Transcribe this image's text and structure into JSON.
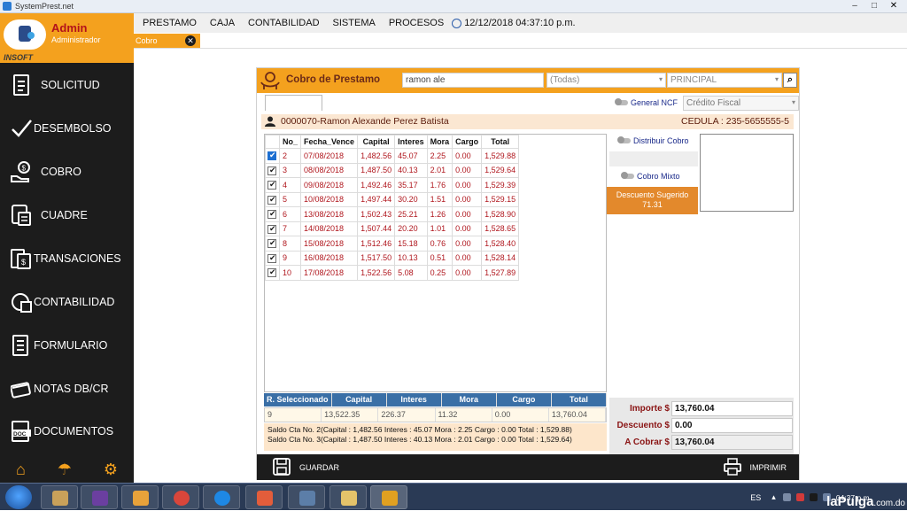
{
  "window": {
    "title": "SystemPrest.net",
    "controls": [
      "–",
      "□",
      "✕"
    ]
  },
  "sidebar": {
    "user_name": "Admin",
    "user_role": "Administrador",
    "brand": "INSOFT",
    "items": [
      {
        "label": "SOLICITUD",
        "icon": "document-icon"
      },
      {
        "label": "DESEMBOLSO",
        "icon": "checkmark-icon"
      },
      {
        "label": "COBRO",
        "icon": "hand-coin-icon"
      },
      {
        "label": "CUADRE",
        "icon": "calculator-icon"
      },
      {
        "label": "TRANSACIONES",
        "icon": "money-bills-icon"
      },
      {
        "label": "CONTABILIDAD",
        "icon": "accounting-icon"
      },
      {
        "label": "FORMULARIO",
        "icon": "form-icon"
      },
      {
        "label": "NOTAS DB/CR",
        "icon": "card-icon"
      },
      {
        "label": "DOCUMENTOS",
        "icon": "doc-file-icon"
      }
    ],
    "footer_icons": [
      "home-icon",
      "umbrella-icon",
      "gear-icon"
    ]
  },
  "menubar": {
    "items": [
      "PRESTAMO",
      "CAJA",
      "CONTABILIDAD",
      "SISTEMA",
      "PROCESOS"
    ],
    "datetime": "12/12/2018 04:37:10 p.m."
  },
  "tabs": {
    "active": "Cobro",
    "close": "✕"
  },
  "panel": {
    "title": "Cobro de Prestamo",
    "search_value": "ramon ale",
    "filter_value": "(Todas)",
    "branch_value": "PRINCIPAL",
    "ncf_toggle_label": "General NCF",
    "ncf_type": "Crédito Fiscal",
    "client_name": "0000070-Ramon Alexande Perez Batista",
    "client_cedula": "CEDULA : 235-5655555-5",
    "distribuir_label": "Distribuir Cobro",
    "mixto_label": "Cobro Mixto",
    "descuento_sugerido_label": "Descuento Sugerido",
    "descuento_sugerido_value": "71.31",
    "table": {
      "headers": [
        "No_",
        "Fecha_Vence",
        "Capital",
        "Interes",
        "Mora",
        "Cargo",
        "Total"
      ],
      "rows": [
        {
          "no": "2",
          "fecha": "07/08/2018",
          "capital": "1,482.56",
          "interes": "45.07",
          "mora": "2.25",
          "cargo": "0.00",
          "total": "1,529.88",
          "checked": true,
          "focus": true
        },
        {
          "no": "3",
          "fecha": "08/08/2018",
          "capital": "1,487.50",
          "interes": "40.13",
          "mora": "2.01",
          "cargo": "0.00",
          "total": "1,529.64",
          "checked": true,
          "focus": false
        },
        {
          "no": "4",
          "fecha": "09/08/2018",
          "capital": "1,492.46",
          "interes": "35.17",
          "mora": "1.76",
          "cargo": "0.00",
          "total": "1,529.39",
          "checked": true,
          "focus": false
        },
        {
          "no": "5",
          "fecha": "10/08/2018",
          "capital": "1,497.44",
          "interes": "30.20",
          "mora": "1.51",
          "cargo": "0.00",
          "total": "1,529.15",
          "checked": true,
          "focus": false
        },
        {
          "no": "6",
          "fecha": "13/08/2018",
          "capital": "1,502.43",
          "interes": "25.21",
          "mora": "1.26",
          "cargo": "0.00",
          "total": "1,528.90",
          "checked": true,
          "focus": false
        },
        {
          "no": "7",
          "fecha": "14/08/2018",
          "capital": "1,507.44",
          "interes": "20.20",
          "mora": "1.01",
          "cargo": "0.00",
          "total": "1,528.65",
          "checked": true,
          "focus": false
        },
        {
          "no": "8",
          "fecha": "15/08/2018",
          "capital": "1,512.46",
          "interes": "15.18",
          "mora": "0.76",
          "cargo": "0.00",
          "total": "1,528.40",
          "checked": true,
          "focus": false
        },
        {
          "no": "9",
          "fecha": "16/08/2018",
          "capital": "1,517.50",
          "interes": "10.13",
          "mora": "0.51",
          "cargo": "0.00",
          "total": "1,528.14",
          "checked": true,
          "focus": false
        },
        {
          "no": "10",
          "fecha": "17/08/2018",
          "capital": "1,522.56",
          "interes": "5.08",
          "mora": "0.25",
          "cargo": "0.00",
          "total": "1,527.89",
          "checked": true,
          "focus": false
        }
      ]
    },
    "summary": {
      "headers": [
        "R. Seleccionado",
        "Capital",
        "Interes",
        "Mora",
        "Cargo",
        "Total"
      ],
      "values": [
        "9",
        "13,522.35",
        "226.37",
        "11.32",
        "0.00",
        "13,760.04"
      ],
      "details": [
        "Saldo Cta No. 2(Capital : 1,482.56 Interes : 45.07 Mora : 2.25 Cargo : 0.00 Total : 1,529.88)",
        "Saldo Cta No. 3(Capital : 1,487.50 Interes : 40.13 Mora : 2.01 Cargo : 0.00 Total : 1,529.64)"
      ]
    },
    "totals": {
      "importe_label": "Importe $",
      "importe_value": "13,760.04",
      "descuento_label": "Descuento $",
      "descuento_value": "0.00",
      "cobrar_label": "A Cobrar $",
      "cobrar_value": "13,760.04"
    },
    "save_label": "GUARDAR",
    "print_label": "IMPRIMIR"
  },
  "taskbar": {
    "lang": "ES",
    "time": "04:37 p.m.",
    "watermark": "laPulga",
    "watermark_domain": ".com.do"
  }
}
